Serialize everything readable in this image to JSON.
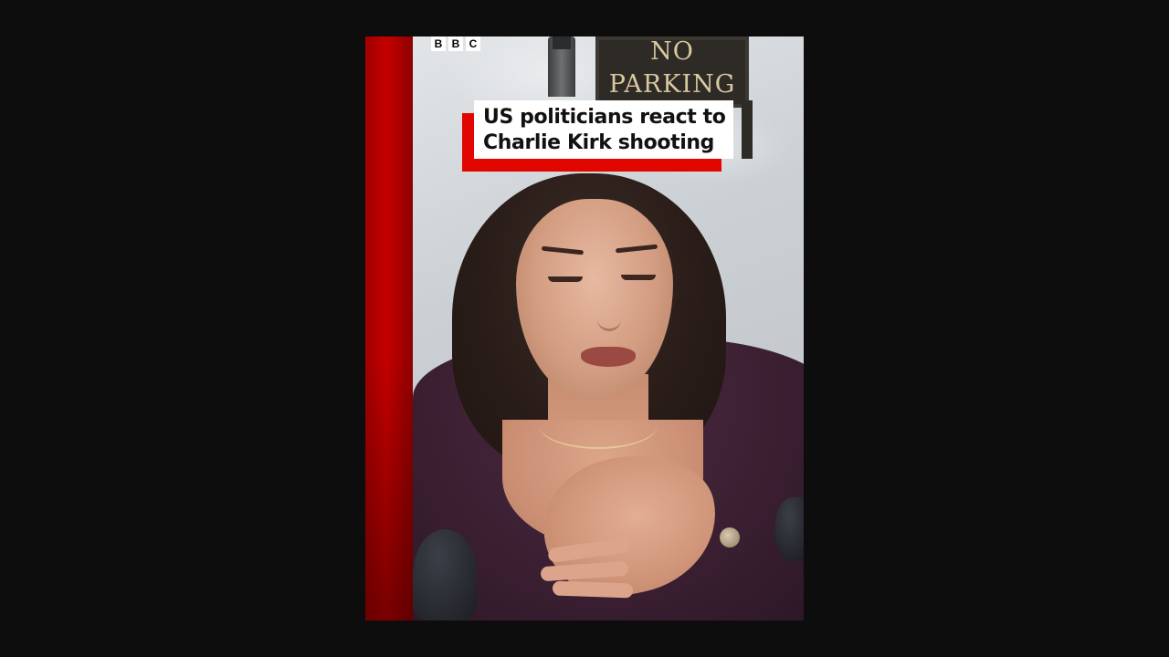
{
  "video": {
    "brand_letters": [
      "B",
      "B",
      "C"
    ],
    "headline_lines": [
      "US politicians react to",
      "Charlie Kirk shooting"
    ],
    "background_sign_lines": [
      "NO",
      "PARKING"
    ],
    "colors": {
      "page_background": "#0d0d0d",
      "brand_red": "#e10600",
      "headline_box": "#ffffff",
      "headline_text": "#111111"
    }
  }
}
